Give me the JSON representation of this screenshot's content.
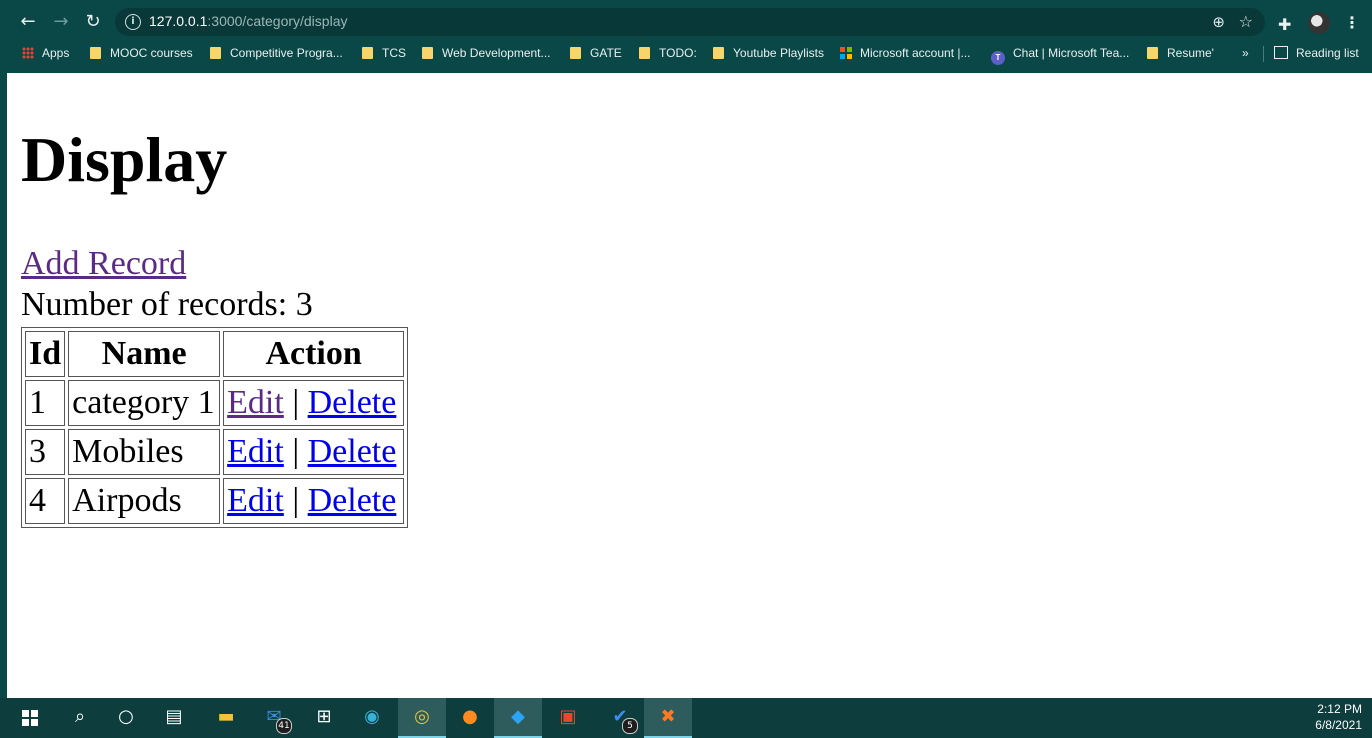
{
  "browser": {
    "url_host": "127.0.0.1",
    "url_path": ":3000/category/display",
    "bookmarks": [
      {
        "label": "Apps",
        "icon": "apps-grid-icon"
      },
      {
        "label": "MOOC courses",
        "icon": "folder-icon"
      },
      {
        "label": "Competitive Progra...",
        "icon": "folder-icon"
      },
      {
        "label": "TCS",
        "icon": "folder-icon"
      },
      {
        "label": "Web Development...",
        "icon": "folder-icon"
      },
      {
        "label": "GATE",
        "icon": "folder-icon"
      },
      {
        "label": "TODO:",
        "icon": "folder-icon"
      },
      {
        "label": "Youtube Playlists",
        "icon": "folder-icon"
      },
      {
        "label": "Microsoft account |...",
        "icon": "microsoft-icon"
      },
      {
        "label": "Chat | Microsoft Tea...",
        "icon": "teams-icon"
      },
      {
        "label": "Resume'",
        "icon": "folder-icon"
      }
    ],
    "overflow_label": "»",
    "reading_list_label": "Reading list"
  },
  "page": {
    "title": "Display",
    "add_link": "Add Record",
    "count_text": "Number of records: 3",
    "table": {
      "headers": [
        "Id",
        "Name",
        "Action"
      ],
      "rows": [
        {
          "id": "1",
          "name": "category 1",
          "edit": "Edit",
          "sep": "|",
          "delete": "Delete"
        },
        {
          "id": "3",
          "name": "Mobiles",
          "edit": "Edit",
          "sep": "|",
          "delete": "Delete"
        },
        {
          "id": "4",
          "name": "Airpods",
          "edit": "Edit",
          "sep": "|",
          "delete": "Delete"
        }
      ]
    }
  },
  "taskbar": {
    "mail_badge": "41",
    "todo_badge": "5",
    "time": "2:12 PM",
    "date": "6/8/2021"
  }
}
